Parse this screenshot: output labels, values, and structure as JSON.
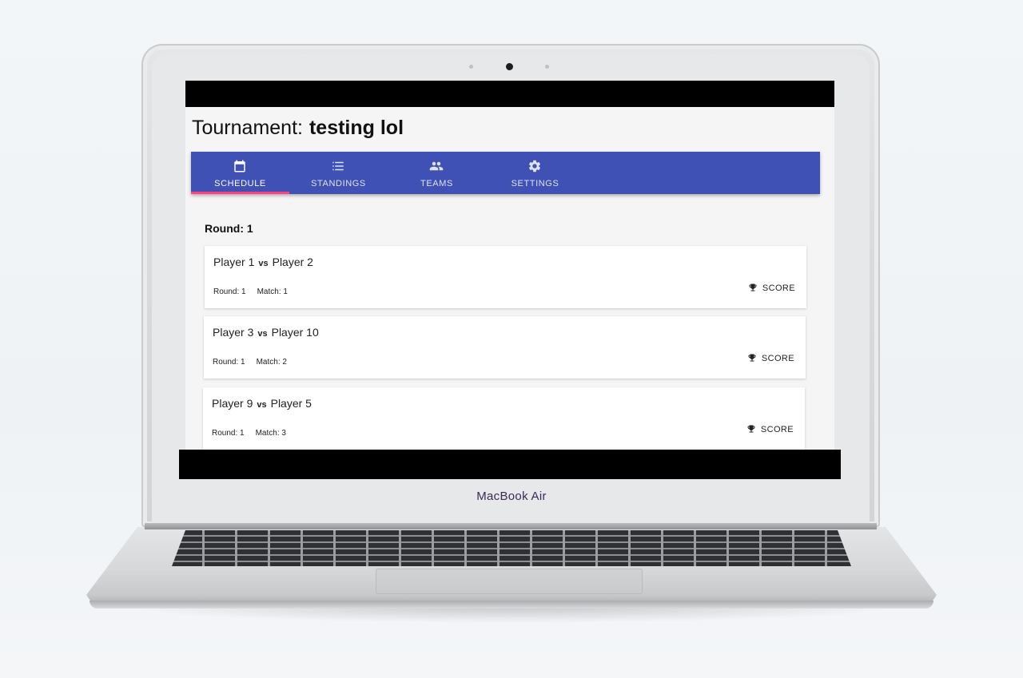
{
  "device": {
    "label": "MacBook Air"
  },
  "app": {
    "title_label": "Tournament:",
    "tournament_name": "testing lol"
  },
  "tabs": [
    {
      "label": "SCHEDULE",
      "icon": "calendar-icon",
      "active": true
    },
    {
      "label": "STANDINGS",
      "icon": "list-icon",
      "active": false
    },
    {
      "label": "TEAMS",
      "icon": "people-icon",
      "active": false
    },
    {
      "label": "SETTINGS",
      "icon": "gear-icon",
      "active": false
    }
  ],
  "schedule": {
    "round_heading": "Round: 1",
    "matches": [
      {
        "player_a": "Player 1",
        "vs": "vs",
        "player_b": "Player 2",
        "round": "Round: 1",
        "match": "Match: 1",
        "action": "SCORE",
        "action_icon": "trophy-icon"
      },
      {
        "player_a": "Player 3",
        "vs": "vs",
        "player_b": "Player 10",
        "round": "Round: 1",
        "match": "Match: 2",
        "action": "SCORE",
        "action_icon": "trophy-icon"
      },
      {
        "player_a": "Player 9",
        "vs": "vs",
        "player_b": "Player 5",
        "round": "Round: 1",
        "match": "Match: 3",
        "action": "SCORE",
        "action_icon": "trophy-icon"
      }
    ]
  },
  "colors": {
    "tab_bar": "#3f51b5",
    "tab_indicator": "#ff4081"
  }
}
